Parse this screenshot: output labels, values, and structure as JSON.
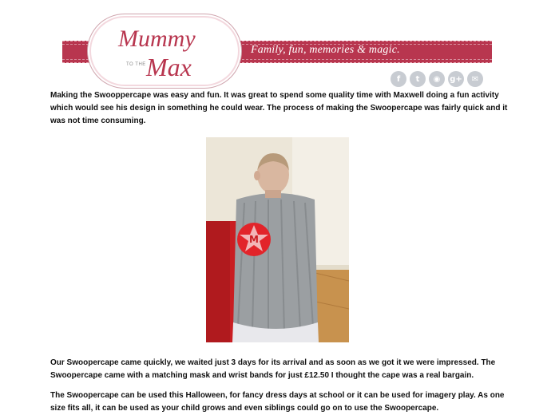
{
  "header": {
    "logo": {
      "line1": "Mummy",
      "line2": "Max",
      "small": "TO THE"
    },
    "tagline": "Family, fun, memories & magic."
  },
  "social": [
    {
      "name": "facebook-icon",
      "glyph": "f"
    },
    {
      "name": "twitter-icon",
      "glyph": "t"
    },
    {
      "name": "rss-icon",
      "glyph": "◉"
    },
    {
      "name": "google-plus-icon",
      "glyph": "g+"
    },
    {
      "name": "email-icon",
      "glyph": "✉"
    }
  ],
  "article": {
    "p1": "Making the Swooppercape was easy and fun. It was great to spend some quality time with Maxwell doing a fun activity which would see his design in something he could wear. The process of making the Swoopercape was fairly quick and it was not time consuming.",
    "p2": "Our Swoopercape came quickly, we waited just 3 days for its arrival and as soon as we got it we were impressed. The Swoopercape came with a matching mask and wrist bands for just £12.50 I thought the cape was a real bargain.",
    "p3": "The Swoopercape can be used this Halloween, for fancy dress days at school or it can be used for imagery play. As one size fits all, it can be used as your child grows and even siblings could go on to use the Swoopercape.",
    "photo": {
      "badge_letter": "M"
    }
  },
  "colors": {
    "brand": "#b8364f",
    "social": "#c8ccd2"
  }
}
